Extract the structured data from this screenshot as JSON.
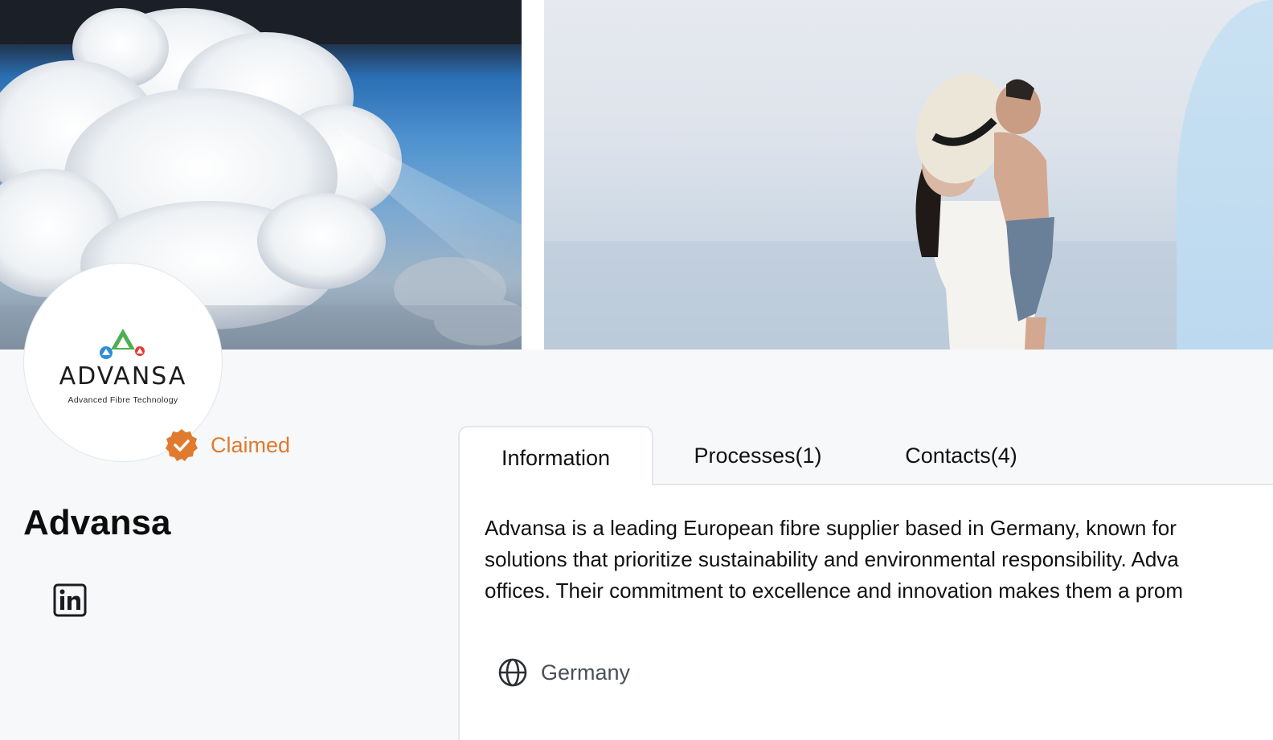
{
  "banner": {
    "left_image": "clouds-sky-photo",
    "right_image": "mother-and-child-by-sea-photo"
  },
  "profile": {
    "logo": {
      "wordmark": "ADVANSA",
      "tagline": "Advanced Fibre Technology"
    },
    "claimed_label": "Claimed",
    "name": "Advansa",
    "social_icon": "linkedin-icon"
  },
  "tabs": [
    {
      "label": "Information",
      "active": true
    },
    {
      "label": "Processes(1)",
      "active": false
    },
    {
      "label": "Contacts(4)",
      "active": false
    }
  ],
  "information": {
    "description_lines": [
      "Advansa is a leading European fibre supplier based in Germany, known for",
      "solutions that prioritize sustainability and environmental responsibility. Adva",
      "offices. Their commitment to excellence and innovation makes them a prom"
    ],
    "location": "Germany",
    "location_icon": "globe-icon"
  },
  "colors": {
    "accent_orange": "#e07a2e",
    "page_bg": "#f7f8fa",
    "border": "#e3e6eb"
  }
}
